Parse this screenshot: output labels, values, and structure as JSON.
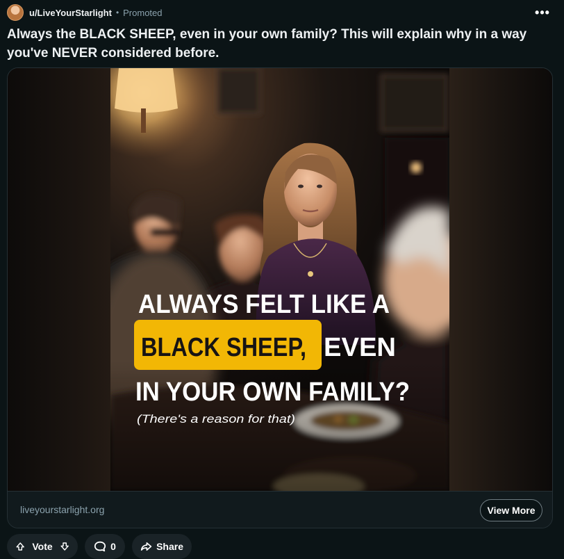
{
  "post": {
    "username": "u/LiveYourStarlight",
    "separator": "•",
    "promoted_label": "Promoted",
    "more_label": "•••",
    "title": "Always the BLACK SHEEP, even in your own family? This will explain why in a way you've NEVER considered before."
  },
  "ad_image": {
    "line1": "ALWAYS FELT LIKE A",
    "highlight": "BLACK SHEEP,",
    "line2_rest": "EVEN",
    "line3": "IN YOUR OWN FAMILY?",
    "caption": "(There's a reason for that)",
    "highlight_color": "#f2b705"
  },
  "link": {
    "domain": "liveyourstarlight.org",
    "view_more_label": "View More"
  },
  "actions": {
    "vote_label": "Vote",
    "comment_count": "0",
    "share_label": "Share"
  }
}
